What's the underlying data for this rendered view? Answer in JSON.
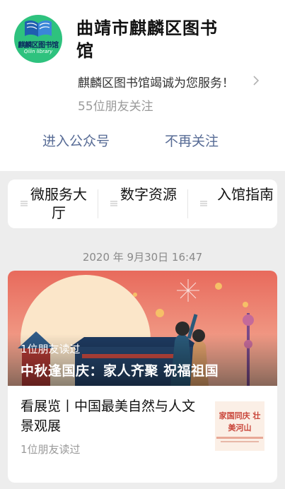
{
  "account": {
    "name": "曲靖市麒麟区图书馆",
    "description": "麒麟区图书馆竭诚为您服务！",
    "followers": "55位朋友关注",
    "avatar": {
      "text_cn": "麒麟区图书馆",
      "text_en": "Qilin library"
    }
  },
  "actions": {
    "enter": "进入公众号",
    "unfollow": "不再关注"
  },
  "menu": [
    {
      "label": "微服务大厅"
    },
    {
      "label": "数字资源"
    },
    {
      "label": "入馆指南"
    }
  ],
  "message_time": "2020 年 9月30日  16:47",
  "articles": [
    {
      "title": "中秋逢国庆：家人齐聚 祝福祖国",
      "read": "1位朋友读过"
    },
    {
      "title": "看展览丨中国最美自然与人文景观展",
      "read": "1位朋友读过",
      "thumb_text": "家国同庆 壮美河山"
    }
  ],
  "colors": {
    "link": "#576b95",
    "avatar_bg": "#2ec27e",
    "page_bg": "#ededed"
  }
}
